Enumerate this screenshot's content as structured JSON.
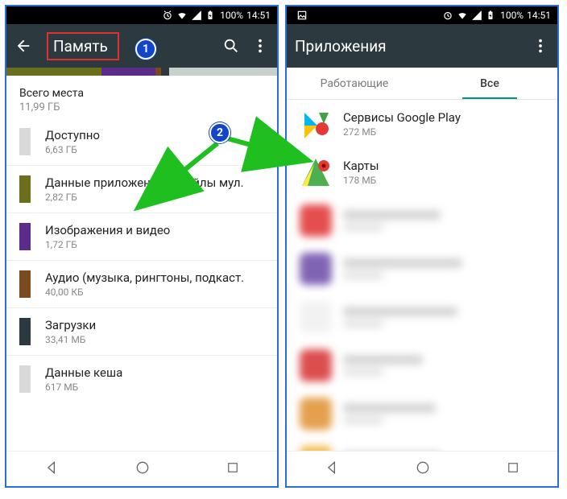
{
  "status": {
    "battery": "100%",
    "time": "14:51"
  },
  "left_screen": {
    "title": "Память",
    "total": {
      "label": "Всего места",
      "value": "11,99 ГБ"
    },
    "items": [
      {
        "label": "Доступно",
        "value": "6,63 ГБ",
        "color": "#d9d9d9"
      },
      {
        "label": "Данные приложений и файлы мул.",
        "value": "2,82 ГБ",
        "color": "#6b6f1d"
      },
      {
        "label": "Изображения и видео",
        "value": "1,72 ГБ",
        "color": "#5b2c8a"
      },
      {
        "label": "Аудио (музыка, рингтоны, подкаст.",
        "value": "40,00 КБ",
        "color": "#7c4a20"
      },
      {
        "label": "Загрузки",
        "value": "33,41 МБ",
        "color": "#2c3a3f"
      },
      {
        "label": "Данные кеша",
        "value": "617 МБ",
        "color": "#d9d9d9"
      }
    ]
  },
  "right_screen": {
    "title": "Приложения",
    "tabs": {
      "running": "Работающие",
      "all": "Все",
      "active": "all"
    },
    "apps": [
      {
        "label": "Сервисы Google Play",
        "size": "272 МБ",
        "icon": "play-services"
      },
      {
        "label": "Карты",
        "size": "178 МБ",
        "icon": "maps"
      }
    ],
    "blurred_placeholders": 6
  },
  "annotations": {
    "badge1": "1",
    "badge2": "2"
  }
}
